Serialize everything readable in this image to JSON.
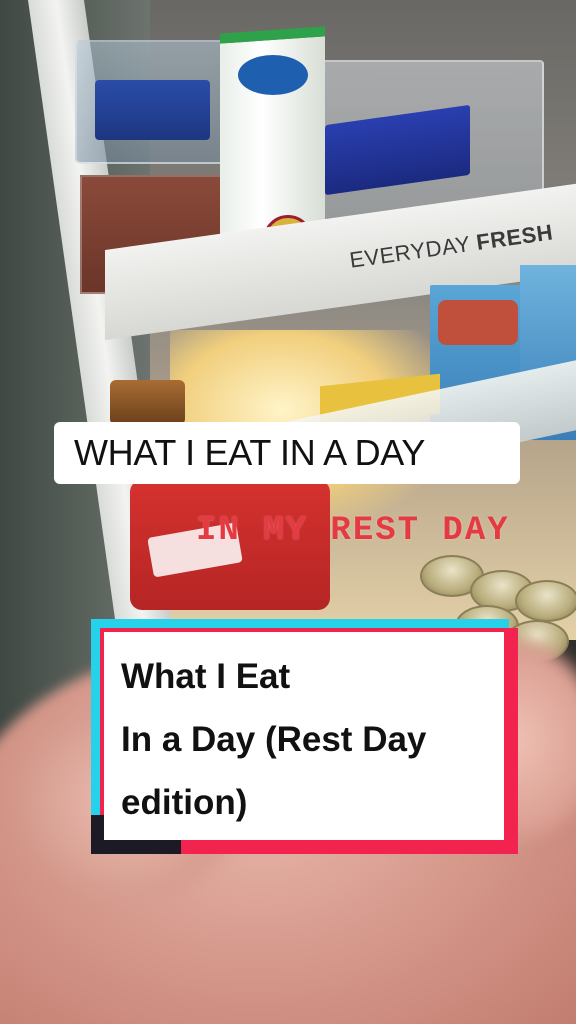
{
  "scene": {
    "shelf_label_light": "EVERYDAY",
    "shelf_label_bold": "FRESH"
  },
  "caption_top": {
    "text": "WHAT I EAT IN A DAY"
  },
  "caption_sub": {
    "text": "IN MY REST DAY",
    "color": "#e63a43"
  },
  "title_card": {
    "line1": "What I Eat",
    "line2": "In a Day (Rest Day",
    "line3": "edition)",
    "colors": {
      "cyan": "#25d2ea",
      "red": "#f2234f",
      "dark": "#1c1b25"
    }
  }
}
